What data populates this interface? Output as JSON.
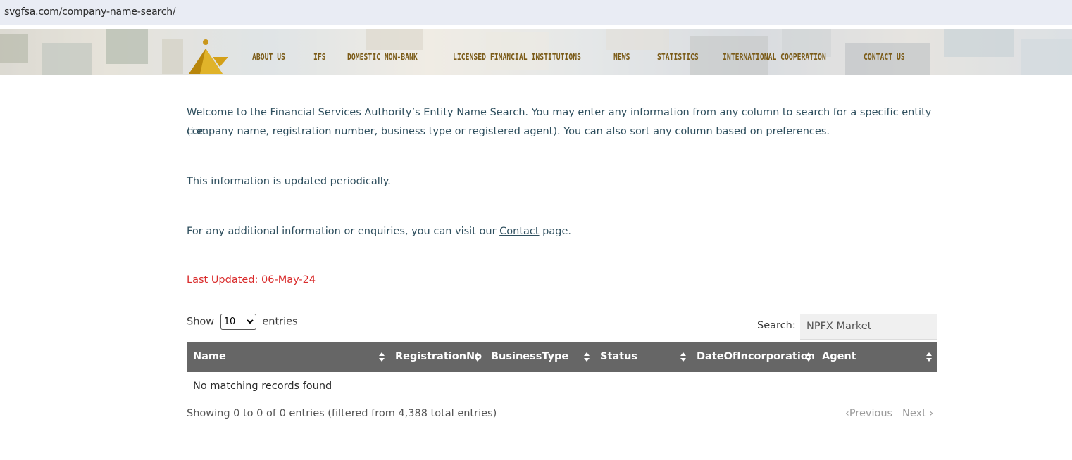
{
  "browser": {
    "url": "svgfsa.com/company-name-search/"
  },
  "nav": {
    "items": [
      "ABOUT US",
      "IFS",
      "DOMESTIC NON-BANK",
      "LICENSED FINANCIAL INSTITUTIONS",
      "NEWS",
      "STATISTICS",
      "INTERNATIONAL COOPERATION",
      "CONTACT US"
    ]
  },
  "intro": {
    "line1": "Welcome to the Financial Services Authority’s Entity Name Search. You may enter any information from any column to search for a specific entity (i.e.",
    "line2": "company name, registration number, business type or registered agent). You can also sort any column based on preferences.",
    "updated_note": "This information is updated periodically.",
    "contact_prefix": "For any additional information or enquiries, you can visit our ",
    "contact_link": "Contact",
    "contact_suffix": " page.",
    "last_updated": "Last Updated:  06-May-24"
  },
  "table": {
    "show_label": "Show",
    "entries_label": "entries",
    "page_length": "10",
    "search_label": "Search:",
    "search_value": "NPFX Market",
    "columns": [
      "Name",
      "RegistrationNo",
      "BusinessType",
      "Status",
      "DateOfIncorporation",
      "Agent"
    ],
    "empty_message": "No matching records found",
    "info": "Showing 0 to 0 of 0 entries (filtered from 4,388 total entries)",
    "previous_label": "Previous",
    "next_label": "Next"
  },
  "colors": {
    "nav_text": "#7a5a16",
    "body_text": "#2f4f5e",
    "last_updated": "#d92b2b",
    "table_header": "#666666"
  }
}
